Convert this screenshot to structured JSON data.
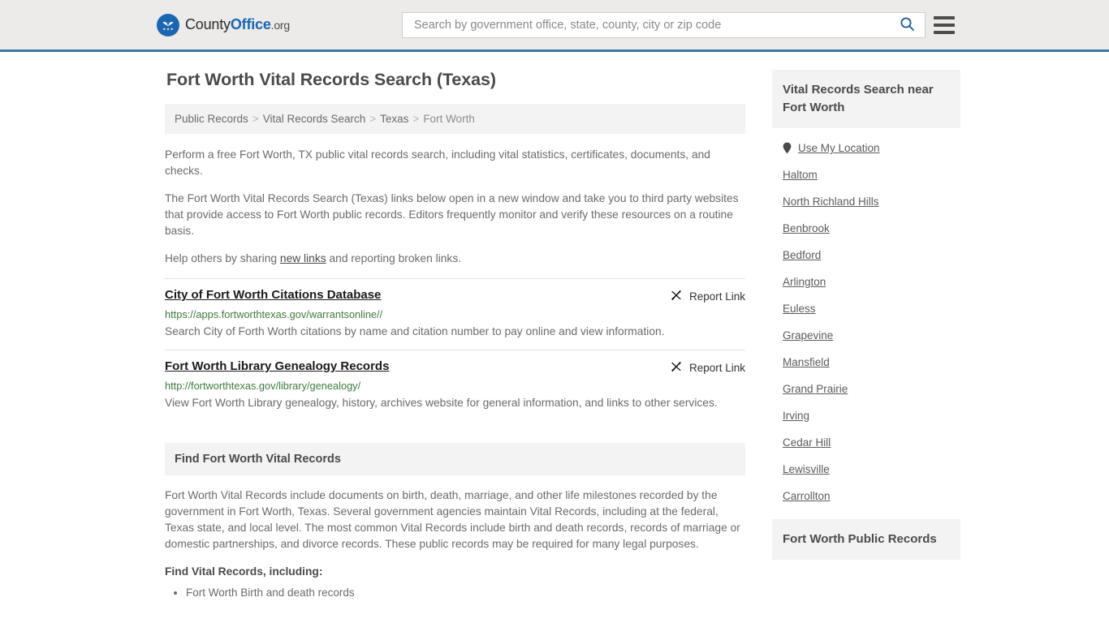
{
  "header": {
    "logo": {
      "prefix": "County",
      "bold": "Office",
      "tld": ".org",
      "icon": "eagle-seal-icon"
    },
    "search": {
      "placeholder": "Search by government office, state, county, city or zip code",
      "value": "",
      "icon": "search-icon"
    },
    "menu_icon": "hamburger-menu-icon"
  },
  "page": {
    "title": "Fort Worth Vital Records Search (Texas)"
  },
  "breadcrumb": {
    "items": [
      {
        "label": "Public Records",
        "current": false
      },
      {
        "label": "Vital Records Search",
        "current": false
      },
      {
        "label": "Texas",
        "current": false
      },
      {
        "label": "Fort Worth",
        "current": true
      }
    ],
    "separator": ">"
  },
  "intro": {
    "paragraph_1": "Perform a free Fort Worth, TX public vital records search, including vital statistics, certificates, documents, and checks.",
    "paragraph_2": "The Fort Worth Vital Records Search (Texas) links below open in a new window and take you to third party websites that provide access to Fort Worth public records. Editors frequently monitor and verify these resources on a routine basis.",
    "paragraph_3_before": "Help others by sharing ",
    "paragraph_3_link": "new links",
    "paragraph_3_after": " and reporting broken links."
  },
  "results": [
    {
      "title": "City of Fort Worth Citations Database",
      "url": "https://apps.fortworthtexas.gov/warrantsonline//",
      "description": "Search City of Forth Worth citations by name and citation number to pay online and view information.",
      "report_label": "Report Link",
      "report_icon": "broken-link-icon"
    },
    {
      "title": "Fort Worth Library Genealogy Records",
      "url": "http://fortworthtexas.gov/library/genealogy/",
      "description": "View Fort Worth Library genealogy, history, archives website for general information, and links to other services.",
      "report_label": "Report Link",
      "report_icon": "broken-link-icon"
    }
  ],
  "find_section": {
    "heading": "Find Fort Worth Vital Records",
    "body": "Fort Worth Vital Records include documents on birth, death, marriage, and other life milestones recorded by the government in Fort Worth, Texas. Several government agencies maintain Vital Records, including at the federal, Texas state, and local level. The most common Vital Records include birth and death records, records of marriage or domestic partnerships, and divorce records. These public records may be required for many legal purposes.",
    "sub_heading": "Find Vital Records, including:",
    "bullets": [
      "Fort Worth Birth and death records"
    ]
  },
  "sidebar": {
    "nearby_heading": "Vital Records Search near Fort Worth",
    "use_my_location": {
      "label": "Use My Location",
      "icon": "map-pin-icon"
    },
    "cities": [
      "Haltom",
      "North Richland Hills",
      "Benbrook",
      "Bedford",
      "Arlington",
      "Euless",
      "Grapevine",
      "Mansfield",
      "Grand Prairie",
      "Irving",
      "Cedar Hill",
      "Lewisville",
      "Carrollton"
    ],
    "public_records_heading": "Fort Worth Public Records"
  },
  "colors": {
    "header_bg": "#ECEBEA",
    "accent_blue": "#3A76A8",
    "logo_blue": "#1B66B0",
    "url_green": "#3E7B3E",
    "panel_gray": "#F3F3F3",
    "text_gray": "#6b6b6b"
  }
}
